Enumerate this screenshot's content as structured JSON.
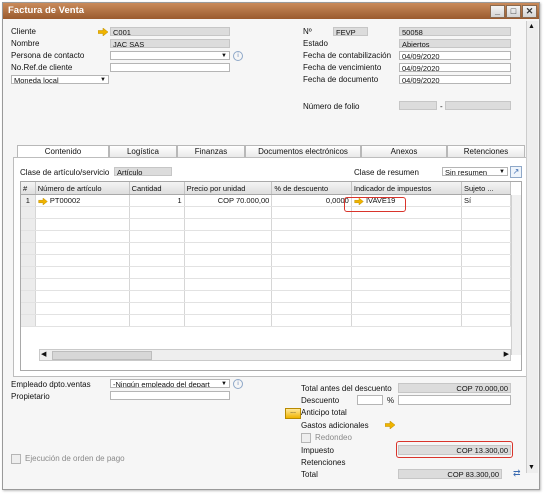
{
  "window": {
    "title": "Factura de Venta"
  },
  "header_left": {
    "cliente": {
      "label": "Cliente",
      "value": "C001"
    },
    "nombre": {
      "label": "Nombre",
      "value": "JAC SAS"
    },
    "persona_contacto": {
      "label": "Persona de contacto",
      "value": ""
    },
    "no_ref_cliente": {
      "label": "No.Ref.de cliente",
      "value": ""
    },
    "moneda": {
      "value": "Moneda local"
    }
  },
  "header_right": {
    "numero": {
      "label": "Nº",
      "series": "FEVP",
      "value": "50058"
    },
    "estado": {
      "label": "Estado",
      "value": "Abiertos"
    },
    "fecha_contabilizacion": {
      "label": "Fecha de contabilización",
      "value": "04/09/2020"
    },
    "fecha_vencimiento": {
      "label": "Fecha de vencimiento",
      "value": "04/09/2020"
    },
    "fecha_documento": {
      "label": "Fecha de documento",
      "value": "04/09/2020"
    },
    "numero_folio": {
      "label": "Número de folio",
      "sep": "-"
    }
  },
  "tabs": [
    {
      "label": "Contenido"
    },
    {
      "label": "Logística"
    },
    {
      "label": "Finanzas"
    },
    {
      "label": "Documentos electrónicos"
    },
    {
      "label": "Anexos"
    },
    {
      "label": "Retenciones"
    }
  ],
  "content": {
    "clase_articulo_label": "Clase de artículo/servicio",
    "clase_articulo_value": "Artículo",
    "clase_resumen_label": "Clase de resumen",
    "clase_resumen_value": "Sin resumen"
  },
  "table": {
    "columns": [
      "#",
      "Número de artículo",
      "Cantidad",
      "Precio por unidad",
      "% de descuento",
      "Indicador de impuestos",
      "Sujeto ..."
    ],
    "rows": [
      {
        "num": "1",
        "item": "PT00002",
        "qty": "1",
        "price": "COP 70.000,00",
        "discount": "0,0000",
        "tax": "IVAVE19",
        "subject": "Sí"
      }
    ]
  },
  "footer_left": {
    "empleado_label": "Empleado dpto.ventas",
    "empleado_value": "-Ningún empleado del depart",
    "propietario_label": "Propietario",
    "ejecucion_label": "Ejecución de orden de pago"
  },
  "totals": {
    "total_antes_label": "Total antes del descuento",
    "total_antes_value": "COP 70.000,00",
    "descuento_label": "Descuento",
    "percent_sign": "%",
    "anticipo_label": "Anticipo total",
    "gastos_label": "Gastos adicionales",
    "redondeo_label": "Redondeo",
    "impuesto_label": "Impuesto",
    "impuesto_value": "COP 13.300,00",
    "retenciones_label": "Retenciones",
    "total_label": "Total",
    "total_value": "COP 83.300,00",
    "ellipsis_button": "..."
  },
  "colors": {
    "title_bar": "#b06a3a",
    "highlight_red": "#d9342b",
    "link_arrow": "#f0b400"
  }
}
